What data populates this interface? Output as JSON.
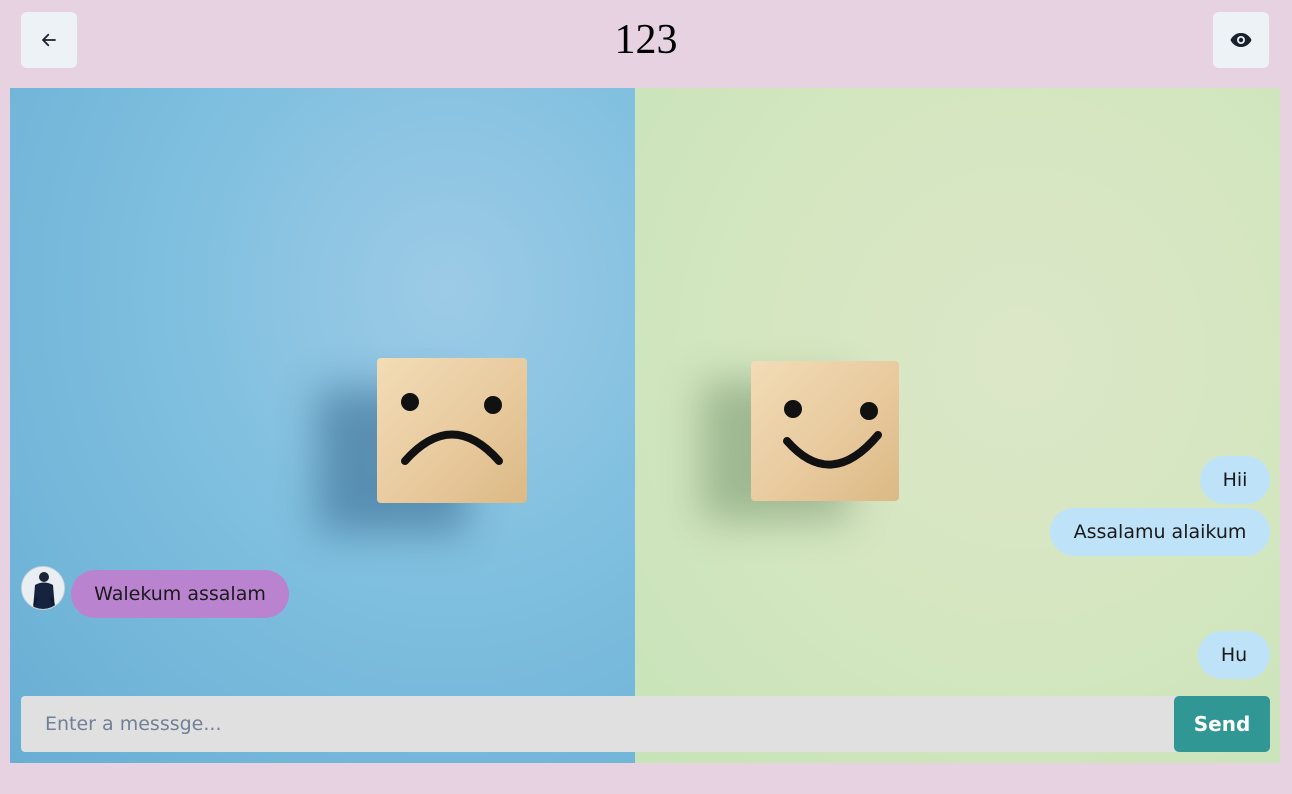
{
  "header": {
    "title": "123",
    "back_icon": "arrow-left-icon",
    "view_icon": "eye-icon"
  },
  "chat": {
    "background_image": "sad-and-happy-face-wooden-cubes",
    "messages": [
      {
        "text": "Hii",
        "direction": "outgoing"
      },
      {
        "text": "Assalamu alaikum",
        "direction": "outgoing"
      },
      {
        "text": "Walekum assalam",
        "direction": "incoming"
      },
      {
        "text": "Hu",
        "direction": "outgoing"
      }
    ]
  },
  "composer": {
    "placeholder": "Enter a messsge...",
    "value": "",
    "send_label": "Send"
  },
  "colors": {
    "page_background": "#e6d2e0",
    "outgoing_bubble": "#bee3f8",
    "incoming_bubble": "#b983cf",
    "send_button": "#319795",
    "icon_button": "#edf2f7",
    "input_background": "#e0e0e0"
  }
}
